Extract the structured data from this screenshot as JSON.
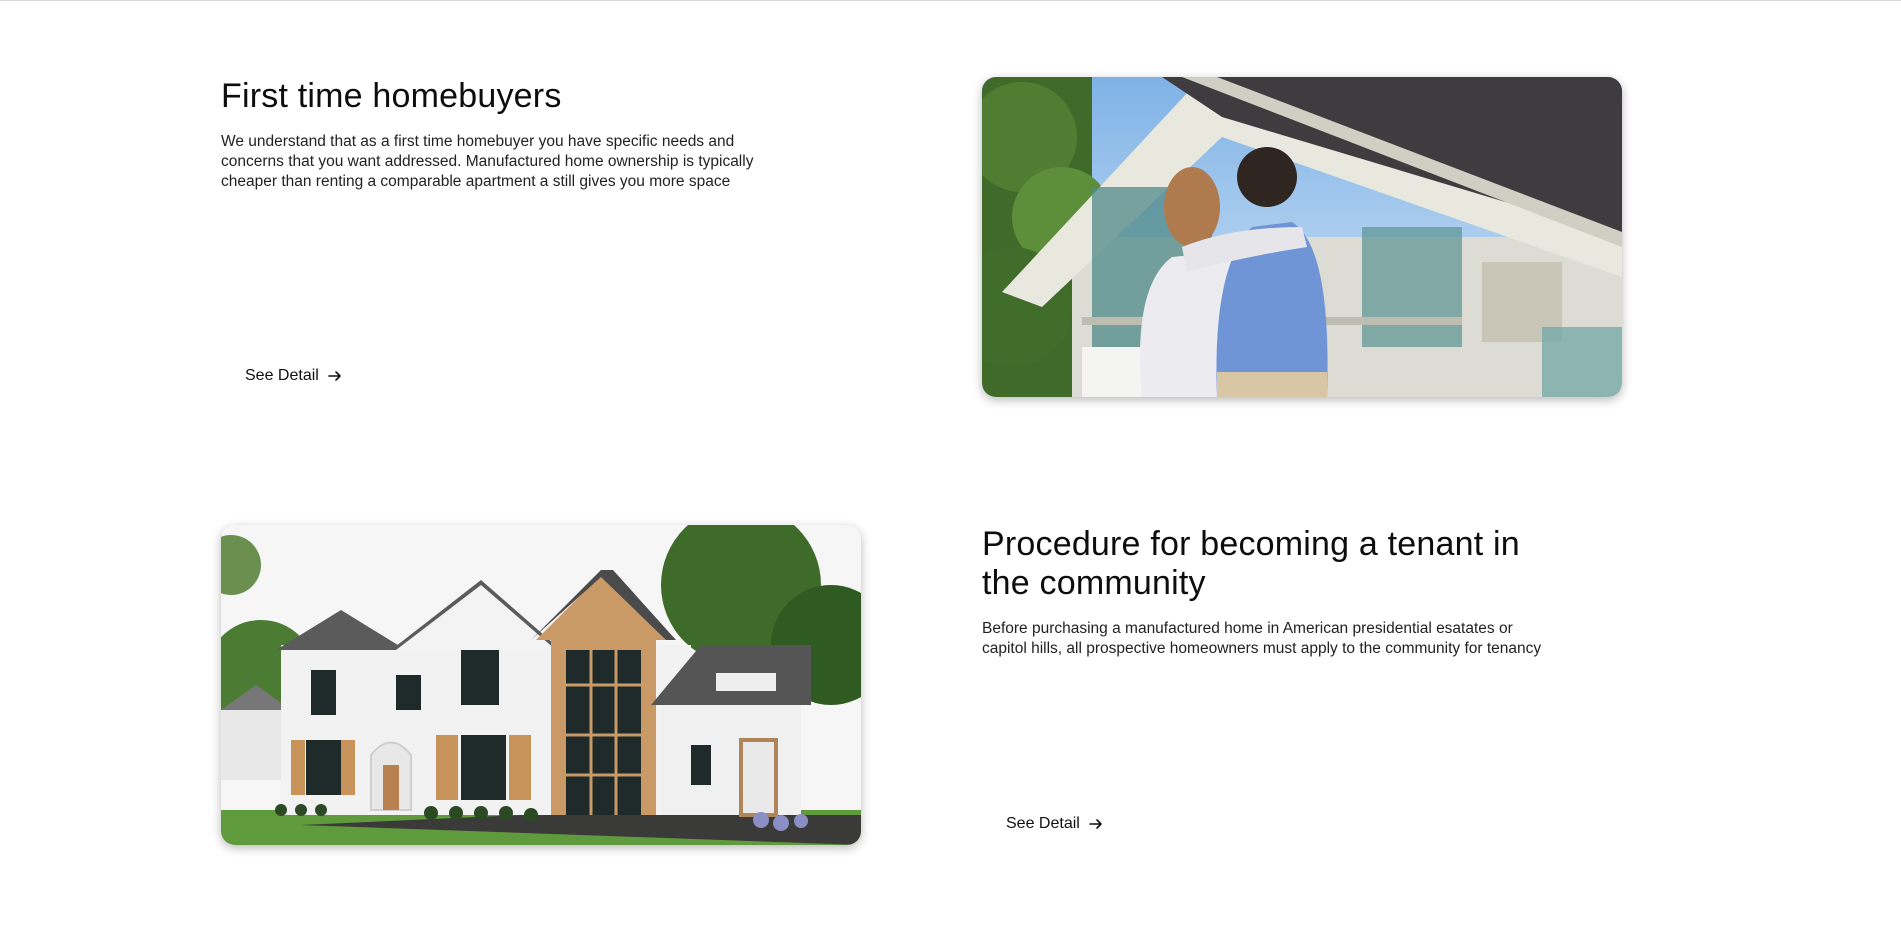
{
  "sections": [
    {
      "heading": "First time homebuyers",
      "description": "We understand that as a first time homebuyer you have specific needs and concerns that you want addressed. Manufactured home ownership is typically cheaper than renting a comparable apartment a still gives you more space",
      "cta_label": "See Detail",
      "cta_icon": "arrow-right-icon",
      "image": "couple-looking-at-house-photo"
    },
    {
      "heading": "Procedure for becoming a tenant in the community",
      "description": "Before purchasing a manufactured home in American presidential esatates or capitol hills, all prospective homeowners must apply to the community for tenancy",
      "cta_label": "See Detail",
      "cta_icon": "arrow-right-icon",
      "image": "white-modern-farmhouse-photo"
    }
  ]
}
